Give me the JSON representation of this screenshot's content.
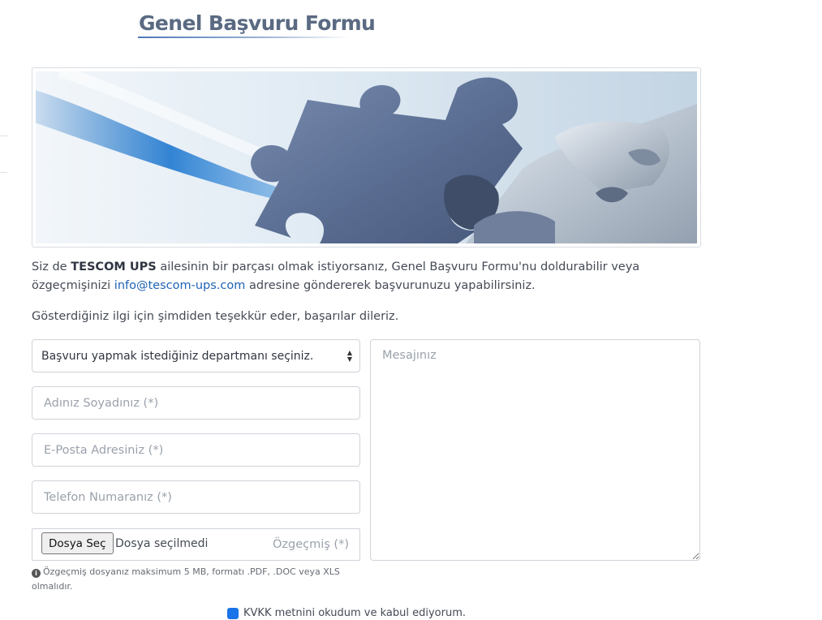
{
  "page": {
    "title": "Genel Başvuru Formu"
  },
  "intro": {
    "text_before": "Siz de ",
    "brand": "TESCOM UPS",
    "text_middle": " ailesinin bir parçası olmak istiyorsanız, Genel Başvuru Formu'nu doldurabilir veya özgeçmişinizi ",
    "email": "info@tescom-ups.com",
    "text_after": " adresine göndererek başvurunuzu yapabilirsiniz.",
    "thanks": "Gösterdiğiniz ilgi için şimdiden teşekkür eder, başarılar dileriz."
  },
  "form": {
    "department_select": {
      "selected": "Başvuru yapmak istediğiniz departmanı seçiniz."
    },
    "name_placeholder": "Adınız Soyadınız (*)",
    "email_placeholder": "E-Posta Adresiniz (*)",
    "phone_placeholder": "Telefon Numaranız (*)",
    "file": {
      "button_label": "Dosya Seç",
      "status": "Dosya seçilmedi",
      "label": "Özgeçmiş (*)"
    },
    "hint": "Özgeçmiş dosyanız maksimum 5 MB, formatı .PDF, .DOC veya XLS olmalıdır.",
    "message_placeholder": "Mesajınız",
    "kvkk_label": "KVKK metnini okudum ve kabul ediyorum."
  },
  "icons": {
    "info": "info-circle-icon",
    "select_arrows": "sort-arrows-icon"
  },
  "colors": {
    "title": "#5a6a82",
    "link": "#1f63b5",
    "border": "#cfd3d9",
    "checkbox": "#1a73e8"
  }
}
